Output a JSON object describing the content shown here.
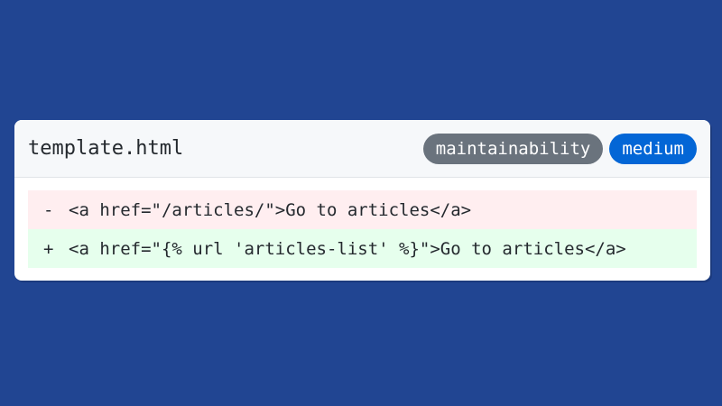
{
  "file": {
    "name": "template.html"
  },
  "badges": {
    "category": "maintainability",
    "severity": "medium"
  },
  "diff": {
    "removed": {
      "marker": "-",
      "code": "<a href=\"/articles/\">Go to articles</a>"
    },
    "added": {
      "marker": "+",
      "code": "<a href=\"{% url 'articles-list' %}\">Go to articles</a>"
    }
  },
  "colors": {
    "background": "#214592",
    "removed_line": "#ffeef0",
    "added_line": "#e6ffed",
    "category_badge": "#6a737d",
    "severity_badge": "#0366d6"
  }
}
